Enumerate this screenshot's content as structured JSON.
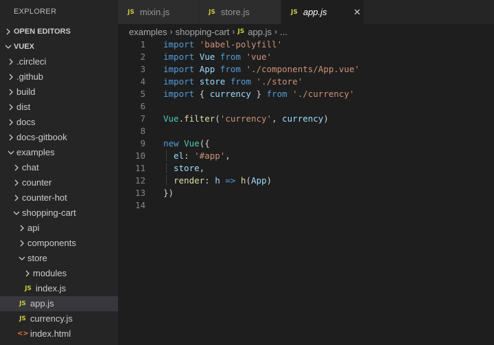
{
  "sidebar": {
    "title": "EXPLORER",
    "open_editors": "OPEN EDITORS",
    "root": "VUEX",
    "tree": [
      {
        "label": ".circleci",
        "depth": 1,
        "type": "folder",
        "open": false
      },
      {
        "label": ".github",
        "depth": 1,
        "type": "folder",
        "open": false
      },
      {
        "label": "build",
        "depth": 1,
        "type": "folder",
        "open": false
      },
      {
        "label": "dist",
        "depth": 1,
        "type": "folder",
        "open": false
      },
      {
        "label": "docs",
        "depth": 1,
        "type": "folder",
        "open": false
      },
      {
        "label": "docs-gitbook",
        "depth": 1,
        "type": "folder",
        "open": false
      },
      {
        "label": "examples",
        "depth": 1,
        "type": "folder",
        "open": true
      },
      {
        "label": "chat",
        "depth": 2,
        "type": "folder",
        "open": false
      },
      {
        "label": "counter",
        "depth": 2,
        "type": "folder",
        "open": false
      },
      {
        "label": "counter-hot",
        "depth": 2,
        "type": "folder",
        "open": false
      },
      {
        "label": "shopping-cart",
        "depth": 2,
        "type": "folder",
        "open": true
      },
      {
        "label": "api",
        "depth": 3,
        "type": "folder",
        "open": false
      },
      {
        "label": "components",
        "depth": 3,
        "type": "folder",
        "open": false
      },
      {
        "label": "store",
        "depth": 3,
        "type": "folder",
        "open": true
      },
      {
        "label": "modules",
        "depth": 4,
        "type": "folder",
        "open": false
      },
      {
        "label": "index.js",
        "depth": 4,
        "type": "js"
      },
      {
        "label": "app.js",
        "depth": 3,
        "type": "js",
        "selected": true
      },
      {
        "label": "currency.js",
        "depth": 3,
        "type": "js"
      },
      {
        "label": "index.html",
        "depth": 3,
        "type": "html"
      }
    ]
  },
  "tabs": [
    {
      "label": "mixin.js",
      "icon": "JS",
      "active": false
    },
    {
      "label": "store.js",
      "icon": "JS",
      "active": false
    },
    {
      "label": "app.js",
      "icon": "JS",
      "active": true
    }
  ],
  "breadcrumb": {
    "items": [
      "examples",
      "shopping-cart",
      "app.js",
      "..."
    ],
    "file_icon": "JS"
  },
  "editor": {
    "line_numbers": [
      "1",
      "2",
      "3",
      "4",
      "5",
      "6",
      "7",
      "8",
      "9",
      "10",
      "11",
      "12",
      "13",
      "14"
    ],
    "lines": [
      [
        {
          "t": "import",
          "c": "kw"
        },
        {
          "t": " "
        },
        {
          "t": "'babel-polyfill'",
          "c": "str"
        }
      ],
      [
        {
          "t": "import",
          "c": "kw"
        },
        {
          "t": " "
        },
        {
          "t": "Vue",
          "c": "id"
        },
        {
          "t": " "
        },
        {
          "t": "from",
          "c": "kw"
        },
        {
          "t": " "
        },
        {
          "t": "'vue'",
          "c": "str"
        }
      ],
      [
        {
          "t": "import",
          "c": "kw"
        },
        {
          "t": " "
        },
        {
          "t": "App",
          "c": "id"
        },
        {
          "t": " "
        },
        {
          "t": "from",
          "c": "kw"
        },
        {
          "t": " "
        },
        {
          "t": "'./components/App.vue'",
          "c": "str"
        }
      ],
      [
        {
          "t": "import",
          "c": "kw"
        },
        {
          "t": " "
        },
        {
          "t": "store",
          "c": "id"
        },
        {
          "t": " "
        },
        {
          "t": "from",
          "c": "kw"
        },
        {
          "t": " "
        },
        {
          "t": "'./store'",
          "c": "str"
        }
      ],
      [
        {
          "t": "import",
          "c": "kw"
        },
        {
          "t": " { "
        },
        {
          "t": "currency",
          "c": "id"
        },
        {
          "t": " } "
        },
        {
          "t": "from",
          "c": "kw"
        },
        {
          "t": " "
        },
        {
          "t": "'./currency'",
          "c": "str"
        }
      ],
      [],
      [
        {
          "t": "Vue",
          "c": "cls"
        },
        {
          "t": "."
        },
        {
          "t": "filter",
          "c": "fn"
        },
        {
          "t": "("
        },
        {
          "t": "'currency'",
          "c": "str"
        },
        {
          "t": ", "
        },
        {
          "t": "currency",
          "c": "id"
        },
        {
          "t": ")"
        }
      ],
      [],
      [
        {
          "t": "new",
          "c": "kw"
        },
        {
          "t": " "
        },
        {
          "t": "Vue",
          "c": "cls"
        },
        {
          "t": "({"
        }
      ],
      [
        {
          "indent": true
        },
        {
          "t": "el",
          "c": "id"
        },
        {
          "t": ": "
        },
        {
          "t": "'#app'",
          "c": "str"
        },
        {
          "t": ","
        }
      ],
      [
        {
          "indent": true
        },
        {
          "t": "store",
          "c": "id"
        },
        {
          "t": ","
        }
      ],
      [
        {
          "indent": true
        },
        {
          "t": "render",
          "c": "fn"
        },
        {
          "t": ": "
        },
        {
          "t": "h",
          "c": "id"
        },
        {
          "t": " "
        },
        {
          "t": "=>",
          "c": "kw"
        },
        {
          "t": " "
        },
        {
          "t": "h",
          "c": "fn"
        },
        {
          "t": "("
        },
        {
          "t": "App",
          "c": "id"
        },
        {
          "t": ")"
        }
      ],
      [
        {
          "t": "})"
        }
      ],
      []
    ]
  },
  "colors": {
    "sidebar_bg": "#252526",
    "editor_bg": "#1e1e1e",
    "selected_row": "#37373d",
    "js_icon": "#cbcb41",
    "html_icon": "#e37933"
  }
}
